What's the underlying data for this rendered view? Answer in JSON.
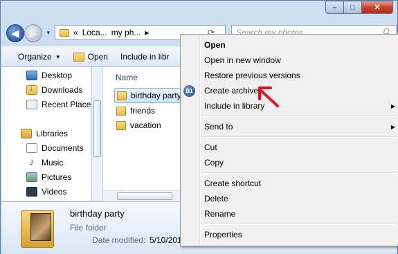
{
  "window": {
    "minimize_label": "–",
    "maximize_label": "□",
    "close_label": "✕"
  },
  "navigation": {
    "back_label": "◀",
    "forward_label": "▶",
    "breadcrumb": [
      "«",
      "Loca...",
      "my ph...",
      "▸"
    ],
    "refresh_label": "⟳",
    "search_placeholder": "Search my photos"
  },
  "toolbar": {
    "organize_label": "Organize",
    "open_label": "Open",
    "include_label": "Include in libr"
  },
  "navpane": {
    "favorites": [
      "Desktop",
      "Downloads",
      "Recent Places"
    ],
    "libraries_label": "Libraries",
    "libraries": [
      "Documents",
      "Music",
      "Pictures",
      "Videos"
    ]
  },
  "filelist": {
    "column_name": "Name",
    "items": [
      "birthday party",
      "friends",
      "vacation"
    ],
    "selected": "birthday party"
  },
  "details": {
    "name": "birthday party",
    "type": "File folder",
    "modified_label": "Date modified:",
    "modified_value": "5/10/201"
  },
  "context_menu": {
    "items": [
      "Open",
      "Open in new window",
      "Restore previous versions",
      "Create archive",
      "Include in library",
      "Send to",
      "Cut",
      "Copy",
      "Create shortcut",
      "Delete",
      "Rename",
      "Properties"
    ],
    "create_archive_icon_text": "B1",
    "submenu_arrow": "▶"
  },
  "icons": {
    "search": "search-icon",
    "folder": "folder-icon",
    "annotation_arrow_color": "#e0141c"
  }
}
